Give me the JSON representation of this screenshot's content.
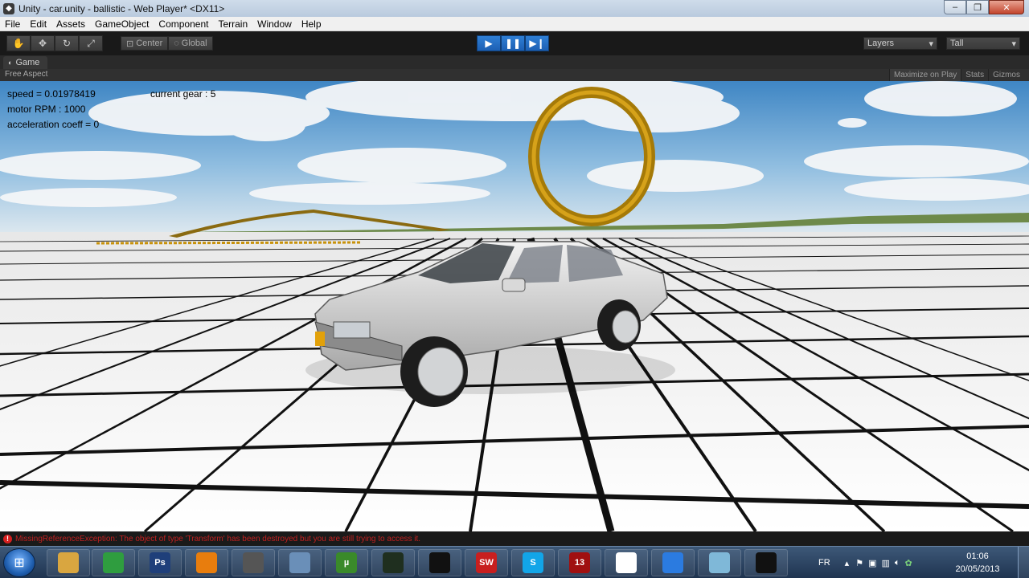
{
  "window": {
    "title": "Unity - car.unity - ballistic - Web Player* <DX11>",
    "buttons": {
      "minimize": "‒",
      "maximize": "❐",
      "close": "✕"
    }
  },
  "menu": [
    "File",
    "Edit",
    "Assets",
    "GameObject",
    "Component",
    "Terrain",
    "Window",
    "Help"
  ],
  "toolbar": {
    "pivot_center": "Center",
    "pivot_global": "Global",
    "layers": "Layers",
    "layout": "Tall",
    "transform_tools": [
      "hand-icon",
      "move-icon",
      "rotate-icon",
      "scale-icon"
    ],
    "play_controls": [
      "play-icon",
      "pause-icon",
      "step-icon"
    ]
  },
  "game_panel": {
    "tab_label": "Game",
    "aspect": "Free Aspect",
    "maximize_on_play": "Maximize on Play",
    "stats": "Stats",
    "gizmos": "Gizmos"
  },
  "hud": {
    "speed": "speed = 0.01978419",
    "rpm": "motor RPM : 1000",
    "accel": "acceleration coeff = 0",
    "gear": "current gear : 5"
  },
  "console": {
    "error": "MissingReferenceException: The object of type 'Transform' has been destroyed but you are still trying to access it."
  },
  "taskbar": {
    "apps": [
      {
        "name": "explorer",
        "glyph": "",
        "color": "#d9a640"
      },
      {
        "name": "chrome",
        "glyph": "",
        "color": "#2f9d3f"
      },
      {
        "name": "photoshop",
        "glyph": "Ps",
        "color": "#1f3f7a"
      },
      {
        "name": "blender",
        "glyph": "",
        "color": "#e87d0d"
      },
      {
        "name": "unity",
        "glyph": "",
        "color": "#555555"
      },
      {
        "name": "remote",
        "glyph": "",
        "color": "#6a8fb8"
      },
      {
        "name": "utorrent",
        "glyph": "µ",
        "color": "#3a8a2a"
      },
      {
        "name": "game-app",
        "glyph": "",
        "color": "#1f2f1f"
      },
      {
        "name": "pdf-app",
        "glyph": "",
        "color": "#111111"
      },
      {
        "name": "solidworks",
        "glyph": "SW",
        "color": "#c81f1f"
      },
      {
        "name": "skype",
        "glyph": "S",
        "color": "#12a5e8"
      },
      {
        "name": "gta",
        "glyph": "13",
        "color": "#a01010"
      },
      {
        "name": "zbrush",
        "glyph": "",
        "color": "#ffffff"
      },
      {
        "name": "dropbox",
        "glyph": "",
        "color": "#2b7be0"
      },
      {
        "name": "notes",
        "glyph": "",
        "color": "#7fb8d8"
      },
      {
        "name": "camera",
        "glyph": "",
        "color": "#111111"
      }
    ],
    "language": "FR",
    "time": "01:06",
    "date": "20/05/2013"
  }
}
